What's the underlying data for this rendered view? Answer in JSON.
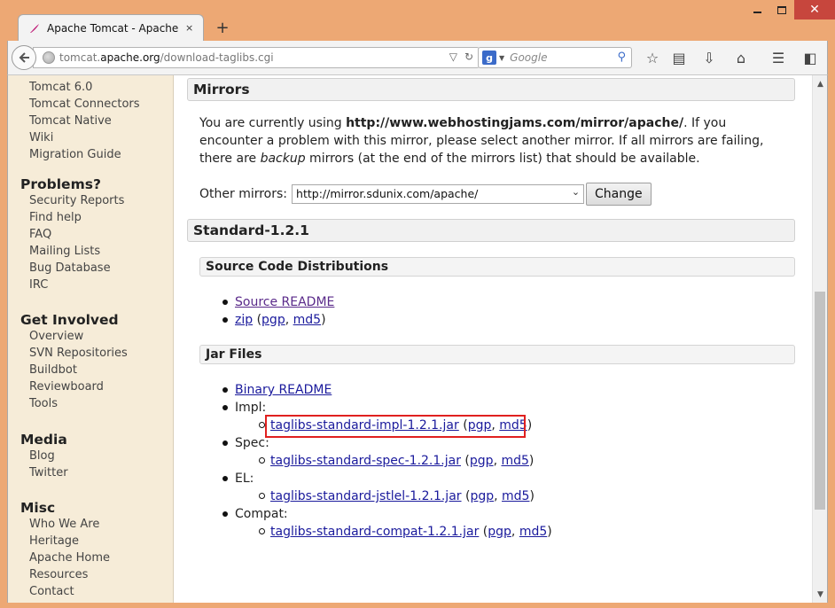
{
  "browser": {
    "tab_title": "Apache Tomcat - Apache ...",
    "tab_close": "×",
    "newtab": "+",
    "url_prefix": "tomcat.",
    "url_host": "apache.org",
    "url_path": "/download-taglibs.cgi",
    "search_engine": "g",
    "search_placeholder": "Google",
    "window_close": "✕"
  },
  "sidebar": {
    "top_links": [
      "Tomcat 6.0",
      "Tomcat Connectors",
      "Tomcat Native",
      "Wiki",
      "Migration Guide"
    ],
    "sections": [
      {
        "heading": "Problems?",
        "links": [
          "Security Reports",
          "Find help",
          "FAQ",
          "Mailing Lists",
          "Bug Database",
          "IRC"
        ]
      },
      {
        "heading": "Get Involved",
        "links": [
          "Overview",
          "SVN Repositories",
          "Buildbot",
          "Reviewboard",
          "Tools"
        ]
      },
      {
        "heading": "Media",
        "links": [
          "Blog",
          "Twitter"
        ]
      },
      {
        "heading": "Misc",
        "links": [
          "Who We Are",
          "Heritage",
          "Apache Home",
          "Resources",
          "Contact"
        ]
      }
    ]
  },
  "main": {
    "mirrors_heading": "Mirrors",
    "para_1": "You are currently using ",
    "para_mirror": "http://www.webhostingjams.com/mirror/apache/",
    "para_2": ". If you encounter a problem with this mirror, please select another mirror. If all mirrors are failing, there are ",
    "para_backup": "backup",
    "para_3": " mirrors (at the end of the mirrors list) that should be available.",
    "other_mirrors_label": "Other mirrors:",
    "other_mirrors_value": "http://mirror.sdunix.com/apache/",
    "change_button": "Change",
    "standard_heading": "Standard-1.2.1",
    "source_heading": "Source Code Distributions",
    "source_readme": "Source README",
    "zip": "zip",
    "pgp": "pgp",
    "md5": "md5",
    "jar_heading": "Jar Files",
    "binary_readme": "Binary README",
    "groups": [
      {
        "label": "Impl:",
        "jar": "taglibs-standard-impl-1.2.1.jar"
      },
      {
        "label": "Spec:",
        "jar": "taglibs-standard-spec-1.2.1.jar"
      },
      {
        "label": "EL:",
        "jar": "taglibs-standard-jstlel-1.2.1.jar"
      },
      {
        "label": "Compat:",
        "jar": "taglibs-standard-compat-1.2.1.jar"
      }
    ]
  },
  "colors": {
    "accent_highlight": "#e0201f",
    "link": "#1a1a9c",
    "visited_link": "#5a2a8a",
    "sidebar_bg": "#f6ecd8"
  }
}
